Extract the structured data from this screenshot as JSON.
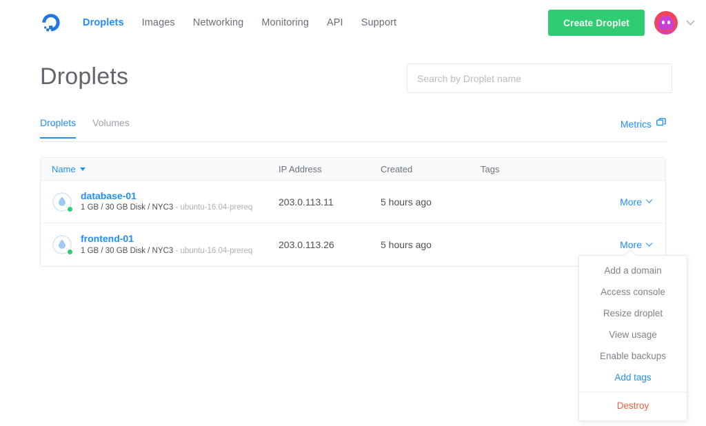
{
  "nav": {
    "logo_icon": "digitalocean-logo-icon",
    "links": [
      {
        "label": "Droplets",
        "active": true
      },
      {
        "label": "Images",
        "active": false
      },
      {
        "label": "Networking",
        "active": false
      },
      {
        "label": "Monitoring",
        "active": false
      },
      {
        "label": "API",
        "active": false
      },
      {
        "label": "Support",
        "active": false
      }
    ],
    "create_button": "Create Droplet",
    "avatar_icon": "user-avatar-icon",
    "account_chevron_icon": "chevron-down-icon"
  },
  "header": {
    "title": "Droplets",
    "search_placeholder": "Search by Droplet name",
    "search_value": ""
  },
  "tabs": [
    {
      "label": "Droplets",
      "active": true
    },
    {
      "label": "Volumes",
      "active": false
    }
  ],
  "metrics": {
    "label": "Metrics",
    "icon": "external-window-icon"
  },
  "table": {
    "columns": {
      "name": "Name",
      "ip": "IP Address",
      "created": "Created",
      "tags": "Tags"
    },
    "sort_icon": "caret-down-icon",
    "more_label": "More",
    "more_icon": "chevron-down-icon",
    "rows": [
      {
        "name": "database-01",
        "spec": "1 GB / 30 GB Disk / NYC3",
        "image": "ubuntu-16.04-prereq",
        "ip": "203.0.113.11",
        "created": "5 hours ago",
        "tags": "",
        "status_icon": "droplet-status-active-icon"
      },
      {
        "name": "frontend-01",
        "spec": "1 GB / 30 GB Disk / NYC3",
        "image": "ubuntu-16.04-prereq",
        "ip": "203.0.113.26",
        "created": "5 hours ago",
        "tags": "",
        "status_icon": "droplet-status-active-icon"
      }
    ]
  },
  "dropdown": {
    "items": [
      {
        "label": "Add a domain",
        "style": "normal"
      },
      {
        "label": "Access console",
        "style": "normal"
      },
      {
        "label": "Resize droplet",
        "style": "normal"
      },
      {
        "label": "View usage",
        "style": "normal"
      },
      {
        "label": "Enable backups",
        "style": "normal"
      },
      {
        "label": "Add tags",
        "style": "highlight"
      }
    ],
    "destructive": {
      "label": "Destroy",
      "style": "danger"
    }
  },
  "colors": {
    "brand_blue": "#1f8dfb",
    "green": "#2fcc71",
    "danger_red": "#e8603c",
    "text_muted": "#9ba2a9"
  }
}
